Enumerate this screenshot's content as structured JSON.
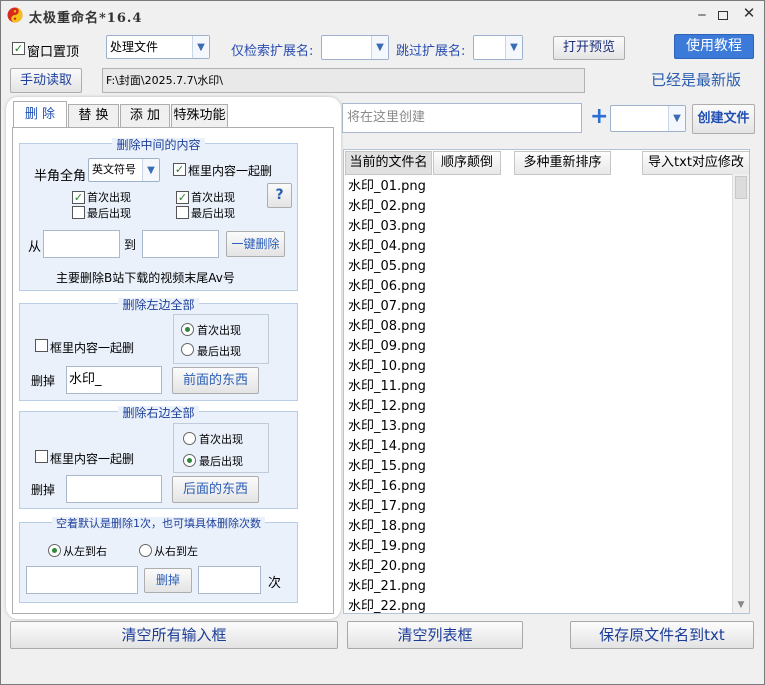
{
  "titlebar": {
    "title": "太极重命名*16.4"
  },
  "toolbar": {
    "window_top_label": "窗口置顶",
    "mode_value": "处理文件",
    "only_ext_label": "仅检索扩展名:",
    "skip_ext_label": "跳过扩展名:",
    "open_preview": "打开预览",
    "tutorial": "使用教程",
    "manual_read": "手动读取",
    "path": "F:\\封面\\2025.7.7\\水印\\",
    "latest_status": "已经是最新版"
  },
  "create": {
    "placeholder": "将在这里创建",
    "plus": "+",
    "create_button": "创建文件"
  },
  "tabs": [
    {
      "label": "删 除"
    },
    {
      "label": "替 换"
    },
    {
      "label": "添 加"
    },
    {
      "label": "特殊功能"
    }
  ],
  "delete_middle": {
    "title": "删除中间的内容",
    "width_label": "半角全角",
    "width_value": "英文符号",
    "with_box_label": "框里内容一起删",
    "left_first": "首次出现",
    "left_last": "最后出现",
    "right_first": "首次出现",
    "right_last": "最后出现",
    "help": "?",
    "from_label": "从",
    "to_label": "到",
    "one_click": "一键删除",
    "hint": "主要删除B站下载的视频末尾Av号"
  },
  "delete_left": {
    "title": "删除左边全部",
    "with_box_label": "框里内容一起删",
    "first": "首次出现",
    "last": "最后出现",
    "remove_label": "删掉",
    "remove_value": "水印_",
    "action": "前面的东西"
  },
  "delete_right": {
    "title": "删除右边全部",
    "with_box_label": "框里内容一起删",
    "first": "首次出现",
    "last": "最后出现",
    "remove_label": "删掉",
    "remove_value": "",
    "action": "后面的东西"
  },
  "delete_count": {
    "title": "空着默认是删除1次，也可填具体删除次数",
    "ltr": "从左到右",
    "rtl": "从右到左",
    "delete_button": "删掉",
    "times_label": "次"
  },
  "list": {
    "headers": [
      "当前的文件名",
      "顺序颠倒",
      "多种重新排序",
      "导入txt对应修改"
    ],
    "files": [
      "水印_01.png",
      "水印_02.png",
      "水印_03.png",
      "水印_04.png",
      "水印_05.png",
      "水印_06.png",
      "水印_07.png",
      "水印_08.png",
      "水印_09.png",
      "水印_10.png",
      "水印_11.png",
      "水印_12.png",
      "水印_13.png",
      "水印_14.png",
      "水印_15.png",
      "水印_16.png",
      "水印_17.png",
      "水印_18.png",
      "水印_19.png",
      "水印_20.png",
      "水印_21.png",
      "水印_22.png"
    ]
  },
  "bottom": {
    "clear_inputs": "清空所有输入框",
    "clear_list": "清空列表框",
    "save_names": "保存原文件名到txt"
  },
  "colors": {
    "accent": "#3b7ad9",
    "panel": "#eaf1fb",
    "label_blue": "#2a4db0"
  }
}
